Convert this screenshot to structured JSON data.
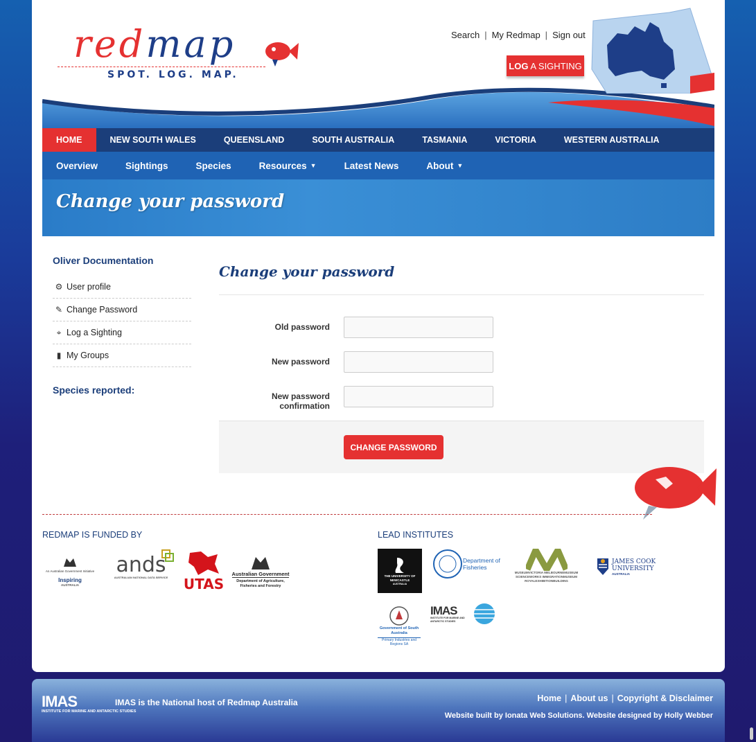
{
  "logo": {
    "word_red": "red",
    "word_blue": "map",
    "tagline": "SPOT. LOG. MAP."
  },
  "toplinks": {
    "search": "Search",
    "my_redmap": "My Redmap",
    "sign_out": "Sign out",
    "separator": "|"
  },
  "log_button": {
    "bold": "LOG",
    "rest": " A SIGHTING"
  },
  "nav_regions": [
    "HOME",
    "NEW SOUTH WALES",
    "QUEENSLAND",
    "SOUTH AUSTRALIA",
    "TASMANIA",
    "VICTORIA",
    "WESTERN AUSTRALIA"
  ],
  "nav_sub": [
    "Overview",
    "Sightings",
    "Species",
    "Resources",
    "Latest News",
    "About"
  ],
  "banner_title": "Change your password",
  "sidebar": {
    "user_name": "Oliver Documentation",
    "items": [
      {
        "label": "User profile",
        "icon": "gear-icon",
        "glyph": "⚙"
      },
      {
        "label": "Change Password",
        "icon": "pencil-icon",
        "glyph": "✎"
      },
      {
        "label": "Log a Sighting",
        "icon": "crosshair-icon",
        "glyph": "⌖"
      },
      {
        "label": "My Groups",
        "icon": "bookmark-icon",
        "glyph": "▮"
      }
    ],
    "species_heading": "Species reported:"
  },
  "form": {
    "title": "Change your password",
    "fields": [
      {
        "label": "Old password",
        "value": ""
      },
      {
        "label": "New password",
        "value": ""
      },
      {
        "label": "New password confirmation",
        "value": ""
      }
    ],
    "submit": "CHANGE PASSWORD"
  },
  "funded": {
    "title": "REDMAP IS FUNDED BY",
    "logos": {
      "gov_init": "An Australian Government Initiative",
      "inspiring": "Inspiring",
      "inspiring_sub": "AUSTRALIA",
      "ands": "ands",
      "ands_sub": "AUSTRALIAN NATIONAL DATA SERVICE",
      "utas": "UTAS",
      "aus_gov": "Australian Government",
      "daff": "Department of Agriculture, Fisheries and Forestry"
    }
  },
  "lead": {
    "title": "LEAD INSTITUTES",
    "logos": {
      "newcastle": "THE UNIVERSITY OF NEWCASTLE",
      "newcastle_sub": "AUSTRALIA",
      "fisheries": "Department of Fisheries",
      "museum": "MUSEUMVICTORIA MELBOURNEMUSEUM SCIENCEWORKS IMMIGRATIONMUSEUM ROYALEXHIBITIONBUILDING",
      "jcu": "JAMES COOK UNIVERSITY",
      "jcu_sub": "AUSTRALIA",
      "sa_gov": "Government of South Australia",
      "pirsa": "Primary Industries and Regions SA",
      "imas": "IMAS",
      "imas_sub": "INSTITUTE FOR MARINE AND ANTARCTIC STUDIES"
    }
  },
  "footer": {
    "imas": "IMAS",
    "imas_sub": "INSTITUTE FOR MARINE AND ANTARCTIC STUDIES",
    "host": "IMAS is the National host of Redmap Australia",
    "links": [
      "Home",
      "About us",
      "Copyright & Disclaimer"
    ],
    "built": "Website built by Ionata Web Solutions. Website designed by Holly Webber"
  },
  "colors": {
    "accent": "#e53131",
    "navy": "#1b3e7a",
    "blue": "#1f63b4"
  }
}
